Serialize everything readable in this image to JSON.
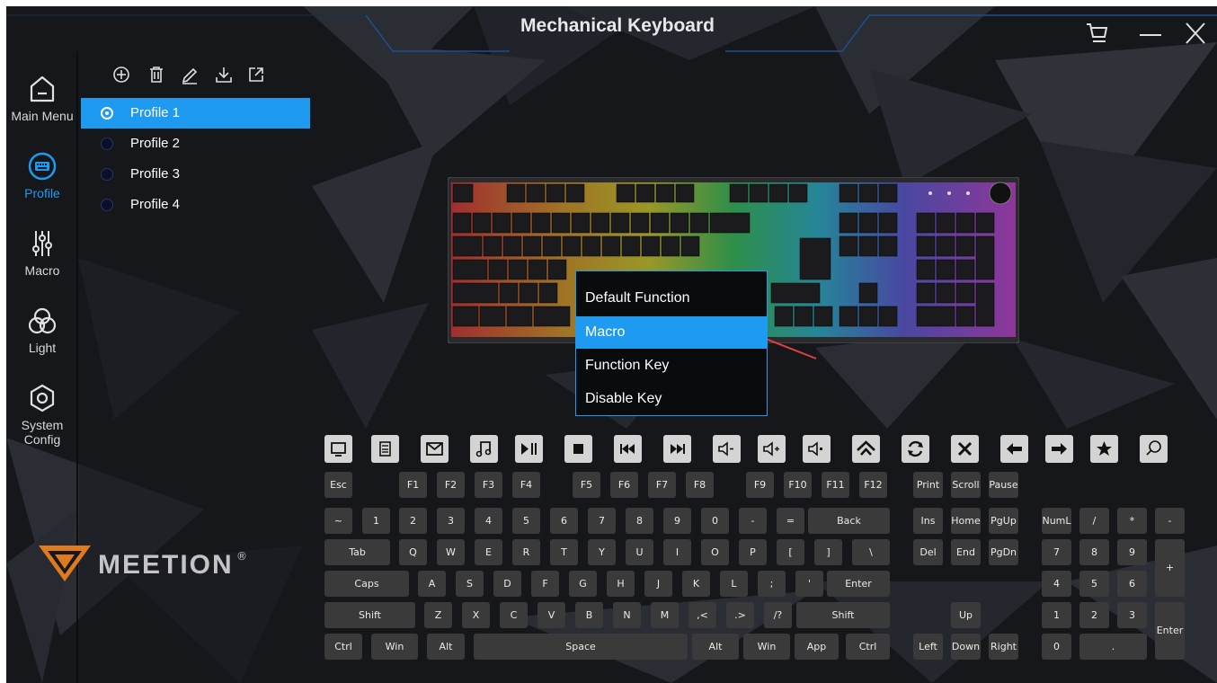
{
  "app": {
    "title": "Mechanical Keyboard"
  },
  "window_buttons": [
    {
      "name": "cart",
      "icon": "cart-icon"
    },
    {
      "name": "minimize",
      "icon": "minimize-icon"
    },
    {
      "name": "close",
      "icon": "close-icon"
    }
  ],
  "nav": {
    "items": [
      {
        "label": "Main Menu",
        "icon": "home-icon"
      },
      {
        "label": "Profile",
        "icon": "keyboard-icon",
        "active": true
      },
      {
        "label": "Macro",
        "icon": "sliders-icon"
      },
      {
        "label": "Light",
        "icon": "light-icon"
      },
      {
        "label": "System Config",
        "label_line1": "System",
        "label_line2": "Config",
        "icon": "settings-icon"
      }
    ]
  },
  "profile_tools": [
    "add-icon",
    "delete-icon",
    "edit-icon",
    "import-icon",
    "export-icon"
  ],
  "profiles": [
    {
      "label": "Profile 1",
      "active": true
    },
    {
      "label": "Profile 2"
    },
    {
      "label": "Profile 3"
    },
    {
      "label": "Profile 4"
    }
  ],
  "context_menu": {
    "items": [
      "Default Function",
      "Macro",
      "Function Key",
      "Disable Key"
    ],
    "selected": "Macro"
  },
  "brand": {
    "logo_text": "MEETION",
    "reg": "®"
  },
  "media_keys": [
    "my-computer-icon",
    "calculator-icon",
    "mail-icon",
    "music-icon",
    "play-pause-icon",
    "stop-icon",
    "previous-track-icon",
    "next-track-icon",
    "volume-down-icon",
    "volume-up-icon",
    "mute-icon",
    "browser-home-icon",
    "refresh-icon",
    "browser-stop-icon",
    "browser-back-icon",
    "browser-forward-icon",
    "favorites-icon",
    "search-icon"
  ],
  "keys": {
    "esc": "Esc",
    "f1": "F1",
    "f2": "F2",
    "f3": "F3",
    "f4": "F4",
    "f5": "F5",
    "f6": "F6",
    "f7": "F7",
    "f8": "F8",
    "f9": "F9",
    "f10": "F10",
    "f11": "F11",
    "f12": "F12",
    "print": "Print",
    "scroll": "Scroll",
    "pause": "Pause",
    "tilde": "~",
    "n1": "1",
    "n2": "2",
    "n3": "3",
    "n4": "4",
    "n5": "5",
    "n6": "6",
    "n7": "7",
    "n8": "8",
    "n9": "9",
    "n0": "0",
    "minus": "-",
    "equal": "=",
    "back": "Back",
    "ins": "Ins",
    "home": "Home",
    "pgup": "PgUp",
    "numl": "NumL",
    "npdiv": "/",
    "npmul": "*",
    "npminus": "-",
    "tab": "Tab",
    "q": "Q",
    "w": "W",
    "e": "E",
    "r": "R",
    "t": "T",
    "y": "Y",
    "u": "U",
    "i": "I",
    "o": "O",
    "p": "P",
    "lbr": "[",
    "rbr": "]",
    "bslash": "\\",
    "del": "Del",
    "end": "End",
    "pgdn": "PgDn",
    "np7": "7",
    "np8": "8",
    "np9": "9",
    "npplus": "+",
    "caps": "Caps",
    "a": "A",
    "s": "S",
    "d": "D",
    "f": "F",
    "g": "G",
    "h": "H",
    "j": "J",
    "k": "K",
    "l": "L",
    "semi": ";",
    "quote": "'",
    "enter": "Enter",
    "np4": "4",
    "np5": "5",
    "np6": "6",
    "lshift": "Shift",
    "z": "Z",
    "x": "X",
    "c": "C",
    "v": "V",
    "b": "B",
    "n": "N",
    "m": "M",
    "comma": ",<",
    "period": ".>",
    "slash": "/?",
    "rshift": "Shift",
    "up": "Up",
    "np1": "1",
    "np2": "2",
    "np3": "3",
    "npenter": "Enter",
    "lctrl": "Ctrl",
    "lwin": "Win",
    "lalt": "Alt",
    "space": "Space",
    "ralt": "Alt",
    "rwin": "Win",
    "app": "App",
    "rctrl": "Ctrl",
    "left": "Left",
    "down": "Down",
    "right": "Right",
    "np0": "0",
    "npdot": "."
  },
  "colors": {
    "accent": "#1e9bf0",
    "background": "#15171b",
    "key": "#3a3a3a",
    "media_key": "#d4d4d4"
  }
}
